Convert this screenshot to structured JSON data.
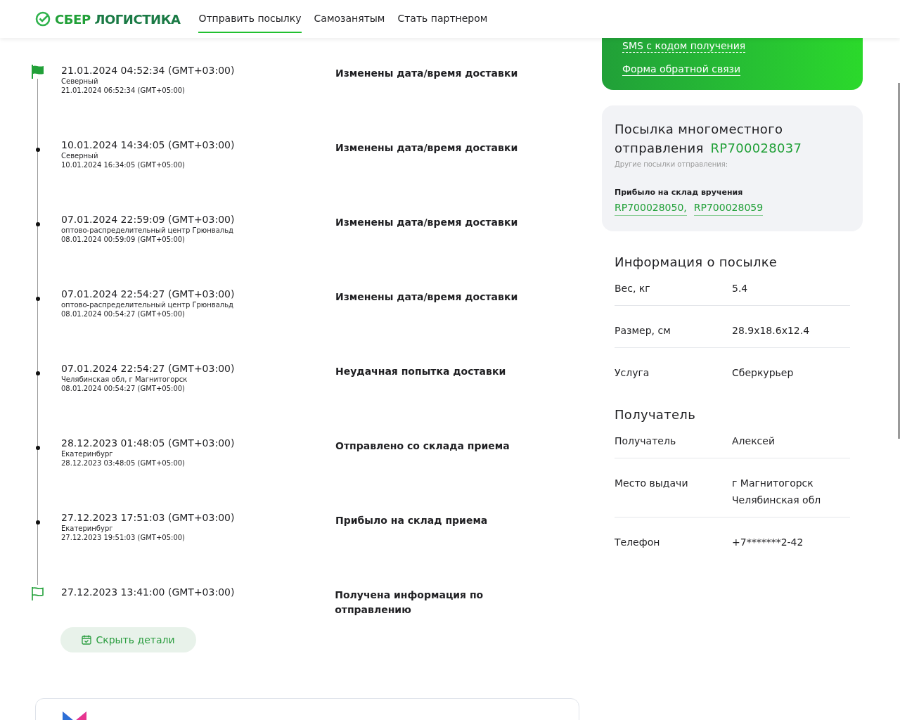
{
  "header": {
    "logo": {
      "brand": "СБЕР",
      "product": "ЛОГИСТИКА"
    },
    "nav": [
      {
        "label": "Отправить посылку",
        "selected": true
      },
      {
        "label": "Самозанятым",
        "selected": false
      },
      {
        "label": "Стать партнером",
        "selected": false
      }
    ]
  },
  "timeline": [
    {
      "kind": "flag-filled",
      "time": "21.01.2024 04:52:34 (GMT+03:00)",
      "place": "Северный",
      "local_time": "21.01.2024 06:52:34 (GMT+05:00)",
      "event": "Изменены дата/время доставки"
    },
    {
      "kind": "dot",
      "time": "10.01.2024 14:34:05 (GMT+03:00)",
      "place": "Северный",
      "local_time": "10.01.2024 16:34:05 (GMT+05:00)",
      "event": "Изменены дата/время доставки"
    },
    {
      "kind": "dot",
      "time": "07.01.2024 22:59:09 (GMT+03:00)",
      "place": "оптово-распределительный центр Грюнвальд",
      "local_time": "08.01.2024 00:59:09 (GMT+05:00)",
      "event": "Изменены дата/время доставки"
    },
    {
      "kind": "dot",
      "time": "07.01.2024 22:54:27 (GMT+03:00)",
      "place": "оптово-распределительный центр Грюнвальд",
      "local_time": "08.01.2024 00:54:27 (GMT+05:00)",
      "event": "Изменены дата/время доставки"
    },
    {
      "kind": "dot",
      "time": "07.01.2024 22:54:27 (GMT+03:00)",
      "place": "Челябинская обл, г Магнитогорск",
      "local_time": "08.01.2024 00:54:27 (GMT+05:00)",
      "event": "Неудачная попытка доставки"
    },
    {
      "kind": "dot",
      "time": "28.12.2023 01:48:05 (GMT+03:00)",
      "place": "Екатеринбург",
      "local_time": "28.12.2023 03:48:05 (GMT+05:00)",
      "event": "Отправлено со склада приема"
    },
    {
      "kind": "dot",
      "time": "27.12.2023 17:51:03 (GMT+03:00)",
      "place": "Екатеринбург",
      "local_time": "27.12.2023 19:51:03 (GMT+05:00)",
      "event": "Прибыло на склад приема"
    },
    {
      "kind": "flag-outline",
      "time": "27.12.2023 13:41:00 (GMT+03:00)",
      "event": "Получена информация по отправлению"
    }
  ],
  "hide_details_button": "Скрыть детали",
  "green_card": {
    "links": [
      "SMS с кодом получения",
      "Форма обратной связи"
    ]
  },
  "multipiece": {
    "title": "Посылка многоместного отправления",
    "number": "RP700028037",
    "subtitle": "Другие посылки отправления:",
    "status": "Прибыло на склад вручения",
    "parcels": [
      "RP700028050,",
      "RP700028059"
    ]
  },
  "parcel_info": {
    "title": "Информация о посылке",
    "rows": [
      {
        "label": "Вес, кг",
        "value": "5.4"
      },
      {
        "label": "Размер, см",
        "value": "28.9x18.6x12.4"
      },
      {
        "label": "Услуга",
        "value": "Сберкурьер"
      }
    ]
  },
  "recipient": {
    "title": "Получатель",
    "rows": [
      {
        "label": "Получатель",
        "value": "Алексей"
      },
      {
        "label": "Место выдачи",
        "value": "г Магнитогорск Челябинская обл"
      },
      {
        "label": "Телефон",
        "value": "+7*******2-42"
      }
    ]
  }
}
